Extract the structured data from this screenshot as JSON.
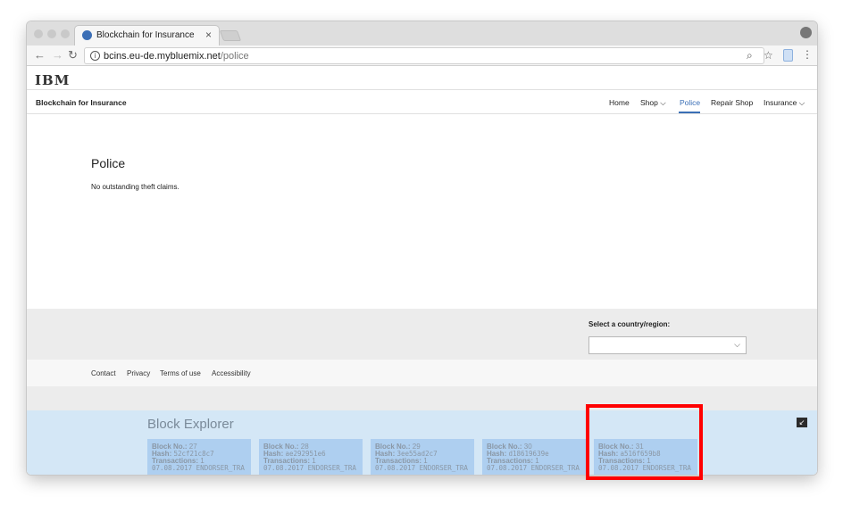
{
  "browser": {
    "tab_title": "Blockchain for Insurance",
    "tab_close": "×",
    "url_host": "bcins.eu-de.mybluemix.net",
    "url_path": "/police",
    "icons": [
      "back-icon",
      "forward-icon",
      "reload-icon",
      "info-icon",
      "zoom-icon",
      "star-icon",
      "extension-icon",
      "menu-icon",
      "profile-icon"
    ]
  },
  "masthead": {
    "logo": "IBM"
  },
  "nav": {
    "site_name": "Blockchain for Insurance",
    "items": [
      {
        "label": "Home"
      },
      {
        "label": "Shop",
        "dropdown": "⌵"
      },
      {
        "label": "Police"
      },
      {
        "label": "Repair Shop"
      },
      {
        "label": "Insurance",
        "dropdown": "⌵"
      }
    ],
    "active": "Police",
    "accent": "#3b6fb6"
  },
  "main": {
    "title": "Police",
    "message": "No outstanding theft claims."
  },
  "footer": {
    "country_label": "Select a country/region:",
    "country_value": "",
    "links": [
      "Contact",
      "Privacy",
      "Terms of use",
      "Accessibility"
    ]
  },
  "explorer": {
    "title": "Block Explorer",
    "collapse_symbol": "↙",
    "labels": {
      "block_no": "Block No.:",
      "hash": "Hash:",
      "transactions": "Transactions:"
    },
    "blocks": [
      {
        "number": "27",
        "hash": "52cf21c8c7",
        "transactions": "1",
        "info": "07.08.2017 ENDORSER_TRA"
      },
      {
        "number": "28",
        "hash": "ae292951e6",
        "transactions": "1",
        "info": "07.08.2017 ENDORSER_TRA"
      },
      {
        "number": "29",
        "hash": "3ee55ad2c7",
        "transactions": "1",
        "info": "07.08.2017 ENDORSER_TRA"
      },
      {
        "number": "30",
        "hash": "d18619639e",
        "transactions": "1",
        "info": "07.08.2017 ENDORSER_TRA"
      },
      {
        "number": "31",
        "hash": "a516f659b8",
        "transactions": "1",
        "info": "07.08.2017 ENDORSER_TRA"
      }
    ]
  },
  "highlight_color": "#ff0000"
}
